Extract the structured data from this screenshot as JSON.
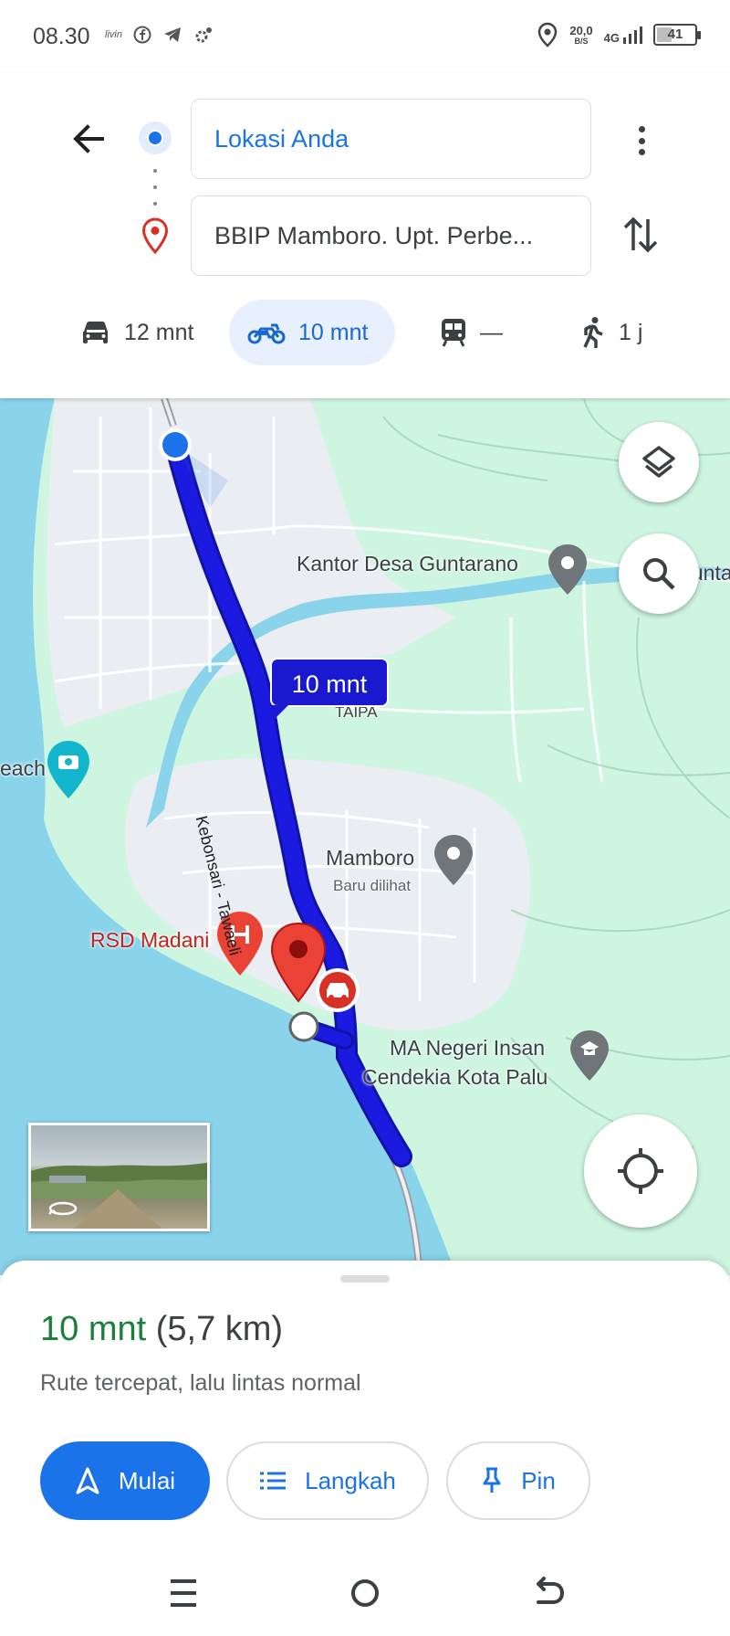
{
  "status_bar": {
    "time": "08.30",
    "left_icons": [
      "livin-icon",
      "facebook-icon",
      "telegram-icon",
      "settings-icon"
    ],
    "net_speed_value": "20,0",
    "net_speed_unit": "B/S",
    "network": "4G",
    "battery": "41",
    "battery_level": 0.41
  },
  "directions": {
    "origin": "Lokasi Anda",
    "destination": "BBIP Mamboro. Upt. Perbe...",
    "modes": [
      {
        "icon": "car-icon",
        "label": "12 mnt",
        "active": false
      },
      {
        "icon": "motorcycle-icon",
        "label": "10 mnt",
        "active": true
      },
      {
        "icon": "transit-icon",
        "label": "—",
        "active": false
      },
      {
        "icon": "walk-icon",
        "label": "1 j",
        "active": false
      }
    ]
  },
  "map": {
    "eta_bubble": "10 mnt",
    "labels": {
      "kantor_desa": "Kantor Desa Guntarano",
      "kantor_desa_clipped": "Gunta",
      "taipa": "TAIPA",
      "beach": "each",
      "street": "Kebonsari - Tawaeli",
      "mamboro": "Mamboro",
      "mamboro_sub": "Baru dilihat",
      "rsd_madani": "RSD Madani",
      "ma_negeri_line1": "MA Negeri Insan",
      "ma_negeri_line2": "Cendekia Kota Palu"
    },
    "colors": {
      "water": "#8ad4eb",
      "land": "#cdf5e0",
      "urban": "#eaedf1",
      "route": "#1a1ae0",
      "route_border": "#1212a8"
    }
  },
  "sheet": {
    "duration": "10 mnt",
    "distance": "(5,7 km)",
    "description": "Rute tercepat, lalu lintas normal",
    "buttons": {
      "start": "Mulai",
      "steps": "Langkah",
      "pin": "Pin"
    }
  }
}
